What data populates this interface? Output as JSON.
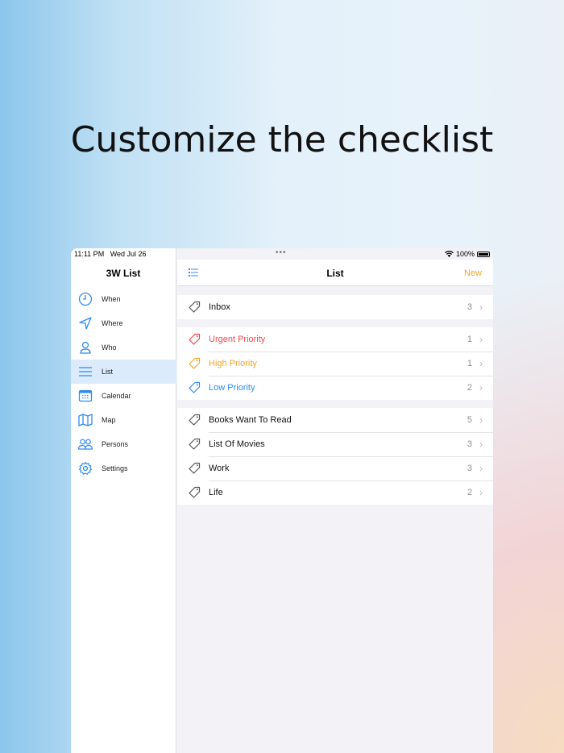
{
  "headline": "Customize the checklist",
  "status": {
    "time": "11:11 PM",
    "date": "Wed Jul 26",
    "battery": "100%"
  },
  "sidebar": {
    "title": "3W List",
    "items": [
      {
        "label": "When",
        "icon": "clock-icon"
      },
      {
        "label": "Where",
        "icon": "location-arrow-icon"
      },
      {
        "label": "Who",
        "icon": "person-icon"
      },
      {
        "label": "List",
        "icon": "list-icon",
        "selected": true
      },
      {
        "label": "Calendar",
        "icon": "calendar-icon"
      },
      {
        "label": "Map",
        "icon": "map-icon"
      },
      {
        "label": "Persons",
        "icon": "persons-icon"
      },
      {
        "label": "Settings",
        "icon": "gear-icon"
      }
    ]
  },
  "header": {
    "title": "List",
    "new_label": "New"
  },
  "groups": [
    [
      {
        "label": "Inbox",
        "count": "3",
        "color": "#555555"
      }
    ],
    [
      {
        "label": "Urgent Priority",
        "count": "1",
        "color": "#f0494b"
      },
      {
        "label": "High Priority",
        "count": "1",
        "color": "#f5a623"
      },
      {
        "label": "Low Priority",
        "count": "2",
        "color": "#2d8cf0"
      }
    ],
    [
      {
        "label": "Books Want To Read",
        "count": "5",
        "color": "#555555"
      },
      {
        "label": "List Of Movies",
        "count": "3",
        "color": "#555555"
      },
      {
        "label": "Work",
        "count": "3",
        "color": "#555555"
      },
      {
        "label": "Life",
        "count": "2",
        "color": "#555555"
      }
    ]
  ],
  "accent": "#2d8cf0"
}
